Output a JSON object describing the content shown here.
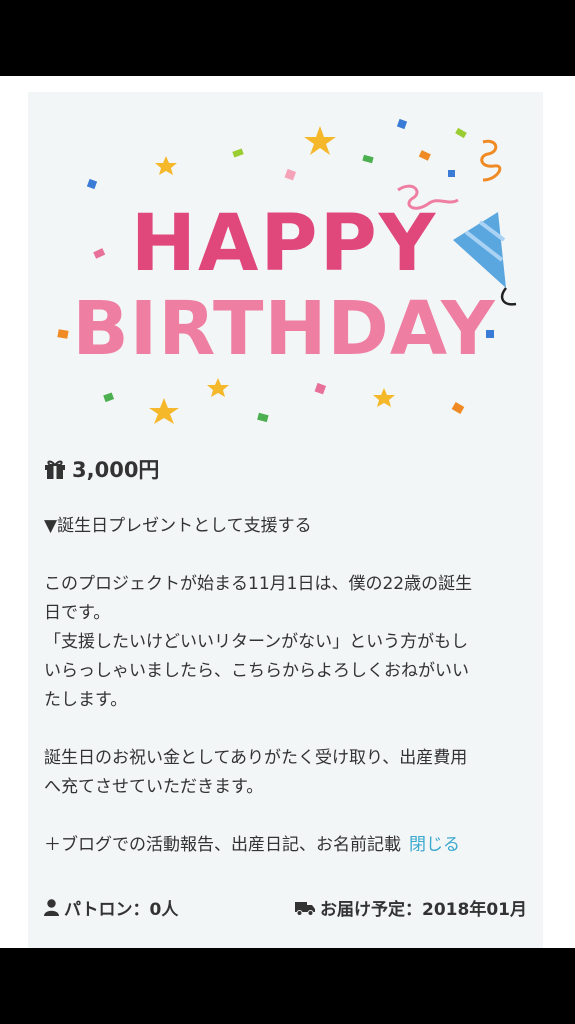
{
  "reward": {
    "hero_image": {
      "alt": "HAPPY BIRTHDAY",
      "line1": "HAPPY",
      "line2": "BIRTHDAY"
    },
    "price": "3,000円",
    "description": {
      "heading": "▼誕生日プレゼントとして支援する",
      "para1_line1": "このプロジェクトが始まる11月1日は、僕の22歳の誕生",
      "para1_line2": "日です。",
      "para2_line1": "「支援したいけどいいリターンがない」という方がもし",
      "para2_line2": "いらっしゃいましたら、こちらからよろしくおねがいい",
      "para2_line3": "たします。",
      "para3_line1": "誕生日のお祝い金としてありがたく受け取り、出産費用",
      "para3_line2": "へ充てさせていただきます。",
      "extras": "＋ブログでの活動報告、出産日記、お名前記載",
      "close_link": "閉じる"
    },
    "patrons": "パトロン：0人",
    "delivery": "お届け予定：2018年01月"
  },
  "colors": {
    "link": "#3aa8cf",
    "hero_pink": "#e0477a",
    "hero_light_pink": "#ee7fa2",
    "card_bg": "#f3f6f7"
  },
  "icons": {
    "price": "gift-icon",
    "patrons": "user-icon",
    "delivery": "truck-icon"
  }
}
